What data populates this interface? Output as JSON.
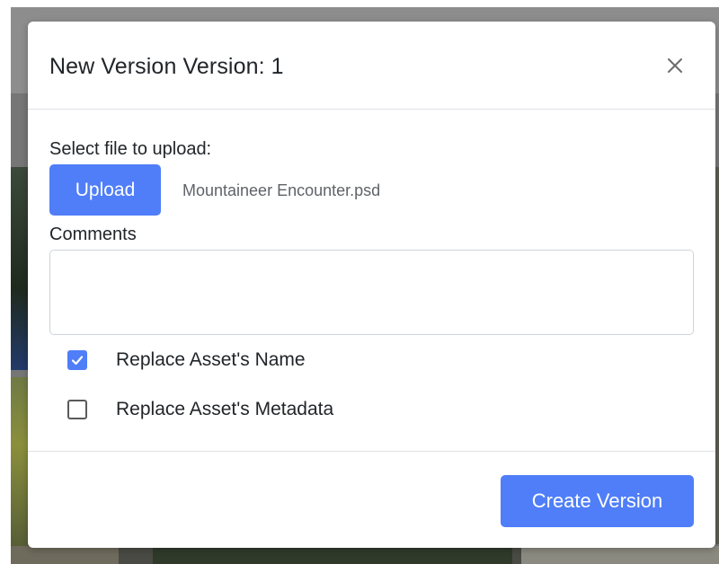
{
  "modal": {
    "title": "New Version Version: 1",
    "close_icon": "close-icon"
  },
  "upload": {
    "label": "Select file to upload:",
    "button_label": "Upload",
    "filename": "Mountaineer Encounter.psd"
  },
  "comments": {
    "label": "Comments",
    "value": "",
    "placeholder": ""
  },
  "options": [
    {
      "label": "Replace Asset's Name",
      "checked": true
    },
    {
      "label": "Replace Asset's Metadata",
      "checked": false
    }
  ],
  "footer": {
    "create_label": "Create Version"
  },
  "colors": {
    "accent": "#4f7ef8",
    "backdrop": "#767676"
  }
}
